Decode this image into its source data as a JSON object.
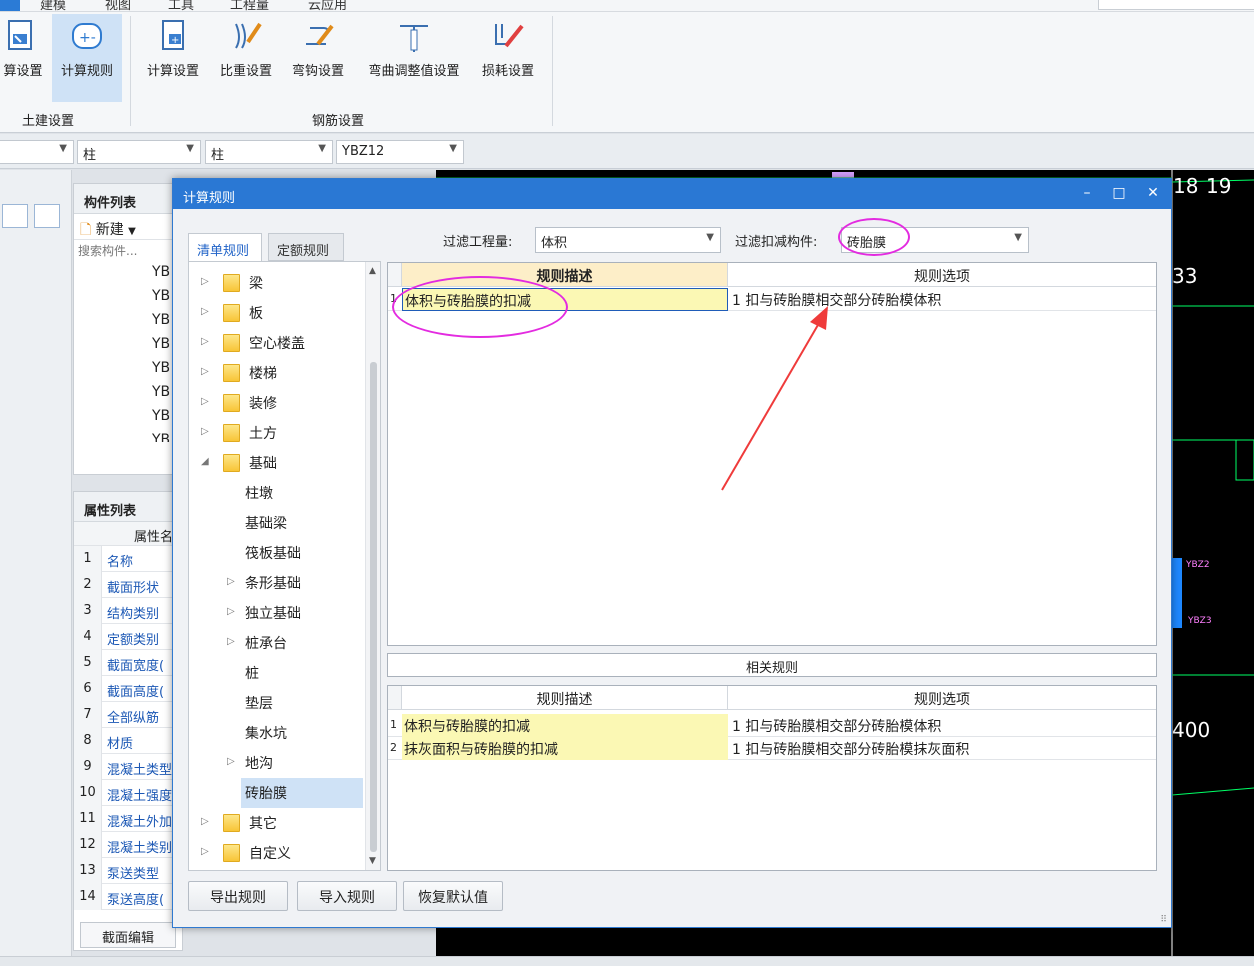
{
  "menubar": {
    "items": [
      "建模",
      "视图",
      "工具",
      "工程量",
      "云应用"
    ]
  },
  "ribbon": {
    "buttons": [
      "算设置",
      "计算规则",
      "计算设置",
      "比重设置",
      "弯钩设置",
      "弯曲调整值设置",
      "损耗设置"
    ],
    "groups": [
      "土建设置",
      "钢筋设置"
    ]
  },
  "toolbar2": {
    "combos": [
      "柱",
      "柱",
      "YBZ12"
    ]
  },
  "comp_panel": {
    "title": "构件列表",
    "new_label": "新建",
    "search_placeholder": "搜索构件...",
    "items": [
      "YB",
      "YB",
      "YB",
      "YB",
      "YB",
      "YB",
      "YB",
      "YB"
    ]
  },
  "prop_panel": {
    "title": "属性列表",
    "col_header": "属性名",
    "rows": [
      {
        "n": "1",
        "name": "名称"
      },
      {
        "n": "2",
        "name": "截面形状"
      },
      {
        "n": "3",
        "name": "结构类别"
      },
      {
        "n": "4",
        "name": "定额类别"
      },
      {
        "n": "5",
        "name": "截面宽度("
      },
      {
        "n": "6",
        "name": "截面高度("
      },
      {
        "n": "7",
        "name": "全部纵筋"
      },
      {
        "n": "8",
        "name": "材质"
      },
      {
        "n": "9",
        "name": "混凝土类型"
      },
      {
        "n": "10",
        "name": "混凝土强度"
      },
      {
        "n": "11",
        "name": "混凝土外加"
      },
      {
        "n": "12",
        "name": "混凝土类别"
      },
      {
        "n": "13",
        "name": "泵送类型"
      },
      {
        "n": "14",
        "name": "泵送高度("
      }
    ],
    "edit_button": "截面编辑"
  },
  "cad": {
    "labels": [
      "18",
      "19",
      "33",
      "400",
      "YBZ2",
      "YBZ3"
    ]
  },
  "dialog": {
    "title": "计算规则",
    "tabs": [
      "清单规则",
      "定额规则"
    ],
    "filter_qty_label": "过滤工程量:",
    "filter_qty_value": "体积",
    "filter_comp_label": "过滤扣减构件:",
    "filter_comp_value": "砖胎膜",
    "tree": [
      {
        "label": "梁",
        "folder": true,
        "expanded": false
      },
      {
        "label": "板",
        "folder": true,
        "expanded": false
      },
      {
        "label": "空心楼盖",
        "folder": true,
        "expanded": false
      },
      {
        "label": "楼梯",
        "folder": true,
        "expanded": false
      },
      {
        "label": "装修",
        "folder": true,
        "expanded": false
      },
      {
        "label": "土方",
        "folder": true,
        "expanded": false
      },
      {
        "label": "基础",
        "folder": true,
        "expanded": true
      },
      {
        "label": "柱墩",
        "level": 1
      },
      {
        "label": "基础梁",
        "level": 1
      },
      {
        "label": "筏板基础",
        "level": 1
      },
      {
        "label": "条形基础",
        "level": 1,
        "expandable": true
      },
      {
        "label": "独立基础",
        "level": 1,
        "expandable": true
      },
      {
        "label": "桩承台",
        "level": 1,
        "expandable": true
      },
      {
        "label": "桩",
        "level": 1
      },
      {
        "label": "垫层",
        "level": 1
      },
      {
        "label": "集水坑",
        "level": 1
      },
      {
        "label": "地沟",
        "level": 1,
        "expandable": true
      },
      {
        "label": "砖胎膜",
        "level": 1,
        "selected": true
      },
      {
        "label": "其它",
        "folder": true,
        "expanded": false
      },
      {
        "label": "自定义",
        "folder": true,
        "expanded": false
      }
    ],
    "main_grid": {
      "headers": [
        "规则描述",
        "规则选项"
      ],
      "rows": [
        {
          "n": "1",
          "desc": "体积与砖胎膜的扣减",
          "opt": "1 扣与砖胎膜相交部分砖胎模体积"
        }
      ]
    },
    "related_title": "相关规则",
    "related_grid": {
      "headers": [
        "规则描述",
        "规则选项"
      ],
      "rows": [
        {
          "n": "1",
          "desc": "体积与砖胎膜的扣减",
          "opt": "1 扣与砖胎膜相交部分砖胎模体积"
        },
        {
          "n": "2",
          "desc": "抹灰面积与砖胎膜的扣减",
          "opt": "1 扣与砖胎膜相交部分砖胎模抹灰面积"
        }
      ]
    },
    "buttons": [
      "导出规则",
      "导入规则",
      "恢复默认值"
    ]
  },
  "colors": {
    "title_bar": "#2a78d4",
    "highlight_cell": "#fbf8b4",
    "annotation": "#e32be0",
    "arrow": "#ef3b3b"
  }
}
